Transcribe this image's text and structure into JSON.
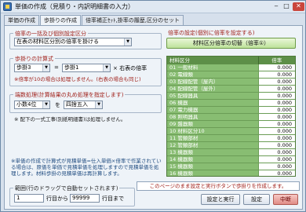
{
  "window": {
    "title": "単価の作成（見積り・内訳明細書の入力）"
  },
  "tabs": [
    "単価の作成",
    "歩掛りの作成",
    "倍率補正ｾｯﾄ,掛率の履歴,区分のセット"
  ],
  "calc_rule": {
    "title": "倍率の一括及び個別設定区分",
    "value": "在表の材料区分別の倍率を掛ける"
  },
  "yield_calc": {
    "title": "歩掛りの計算式",
    "left": "歩掛3",
    "op": "=",
    "right": "歩掛1",
    "suffix": "× 右表の倍率",
    "note": "※倍率が10の場合は処理しません。(右表の場合も同じ)"
  },
  "rounding": {
    "title": "端数処理(計算結果の丸め処理を指定します)",
    "digit": "小数4位",
    "connector": "を",
    "method": "四捨五入"
  },
  "note_line": "※ 配下の一式工事(別紙明細書)は処理しません。",
  "note_block": "※単価の作成で計算式が見積単価=仕入単価×倍率で作業されている場合は、原価を単価で見積単価を処理しますので見積単価を処理します。材料歩掛の見積単価は再計算します。",
  "range": {
    "title": "範囲(行のドラッグで自動セットされます)",
    "from": "1",
    "from_label": "行目から",
    "to": "99999",
    "to_label": "行目まで"
  },
  "rate_panel": {
    "title": "倍率の設定(個別に倍率を設定する)",
    "switch_label": "材料区分倍率の切替（倍率①）",
    "col_material": "材料区分",
    "col_rate": "倍率",
    "rows": [
      {
        "name": "01 一般材料",
        "rate": "0.000"
      },
      {
        "name": "02 電線類",
        "rate": "0.000"
      },
      {
        "name": "03 配線配管（屋内）",
        "rate": "0.000"
      },
      {
        "name": "04 配線配管（屋外）",
        "rate": "0.000"
      },
      {
        "name": "05 配線器具",
        "rate": "0.000"
      },
      {
        "name": "06 機器",
        "rate": "0.000"
      },
      {
        "name": "07 電力機器",
        "rate": "0.000"
      },
      {
        "name": "08 照明器具",
        "rate": "0.000"
      },
      {
        "name": "09 盤器類",
        "rate": "0.000"
      },
      {
        "name": "10 材料区分10",
        "rate": "0.000"
      },
      {
        "name": "11 管類部材",
        "rate": "0.000"
      },
      {
        "name": "12 管類部材",
        "rate": "0.000"
      },
      {
        "name": "13 機器類",
        "rate": "0.000"
      },
      {
        "name": "14 機器類",
        "rate": "0.000"
      },
      {
        "name": "15 機器類",
        "rate": "0.000"
      },
      {
        "name": "16 機器類",
        "rate": "0.000"
      }
    ]
  },
  "bottom_message": "このページのまま設定と実行ボタンで歩掛りを作成します。",
  "buttons": {
    "set_and_run": "設定と実行",
    "set": "設定",
    "cancel": "中断"
  }
}
